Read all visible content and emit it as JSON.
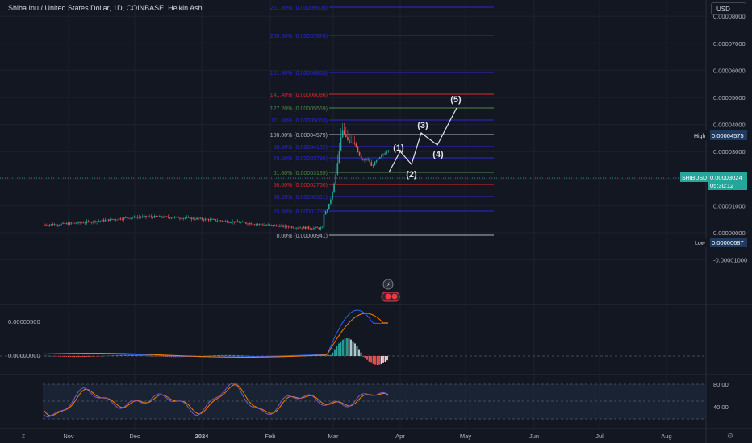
{
  "header": {
    "title": "Shiba Inu / United States Dollar, 1D, COINBASE, Heikin Ashi",
    "currency": "USD"
  },
  "colors": {
    "background": "#131722",
    "grid": "#1e222d",
    "text": "#b2b5be",
    "bull": "#26a69a",
    "bear": "#ef5350",
    "fib_blue": "#2828d6",
    "fib_red": "#e0262d",
    "fib_green": "#4c8a40",
    "fib_white": "#b2b5be",
    "macd_line": "#2962ff",
    "signal_line": "#f57c00",
    "rsi_line": "#7e57c2"
  },
  "price_axis": {
    "ticks": [
      "0.00008000",
      "0.00007000",
      "0.00006000",
      "0.00005000",
      "0.00004000",
      "0.00003000",
      "0.00002000",
      "0.00001000",
      "0.00000000",
      "-0.00001000"
    ],
    "high_label": "High",
    "high_value": "0.00004575",
    "low_label": "Low",
    "low_value": "0.00000687",
    "symbol_label": "SHIBUSD",
    "last_value": "0.00003024",
    "countdown": "05:30:12"
  },
  "fib_levels": [
    {
      "text": "261.80% (0.00009508)",
      "color": "blue"
    },
    {
      "text": "200.00% (0.00007876)",
      "color": "blue"
    },
    {
      "text": "161.80% (0.00006863)",
      "color": "blue"
    },
    {
      "text": "141.40% (0.00006086)",
      "color": "red"
    },
    {
      "text": "127.20% (0.00005569)",
      "color": "green"
    },
    {
      "text": "111.80% (0.00005063)",
      "color": "blue"
    },
    {
      "text": "100.00% (0.00004579)",
      "color": "white"
    },
    {
      "text": "88.60% (0.00004162)",
      "color": "blue"
    },
    {
      "text": "78.60% (0.00003796)",
      "color": "blue"
    },
    {
      "text": "61.80% (0.00003189)",
      "color": "green"
    },
    {
      "text": "50.00% (0.00002760)",
      "color": "red"
    },
    {
      "text": "38.20% (0.00002331)",
      "color": "blue"
    },
    {
      "text": "23.60% (0.00001799)",
      "color": "blue"
    },
    {
      "text": "0.00% (0.00000941)",
      "color": "white"
    }
  ],
  "wave_labels": [
    "(1)",
    "(2)",
    "(3)",
    "(4)",
    "(5)"
  ],
  "macd_axis": {
    "ticks": [
      "0.00000500",
      "0.00000000"
    ]
  },
  "rsi_axis": {
    "ticks": [
      "80.00",
      "40.00"
    ]
  },
  "time_axis": {
    "labels": [
      "Nov",
      "Dec",
      "2024",
      "Feb",
      "Mar",
      "Apr",
      "May",
      "Jun",
      "Jul",
      "Aug"
    ]
  },
  "icons": {
    "timezone": "Z",
    "settings": "gear-icon"
  }
}
